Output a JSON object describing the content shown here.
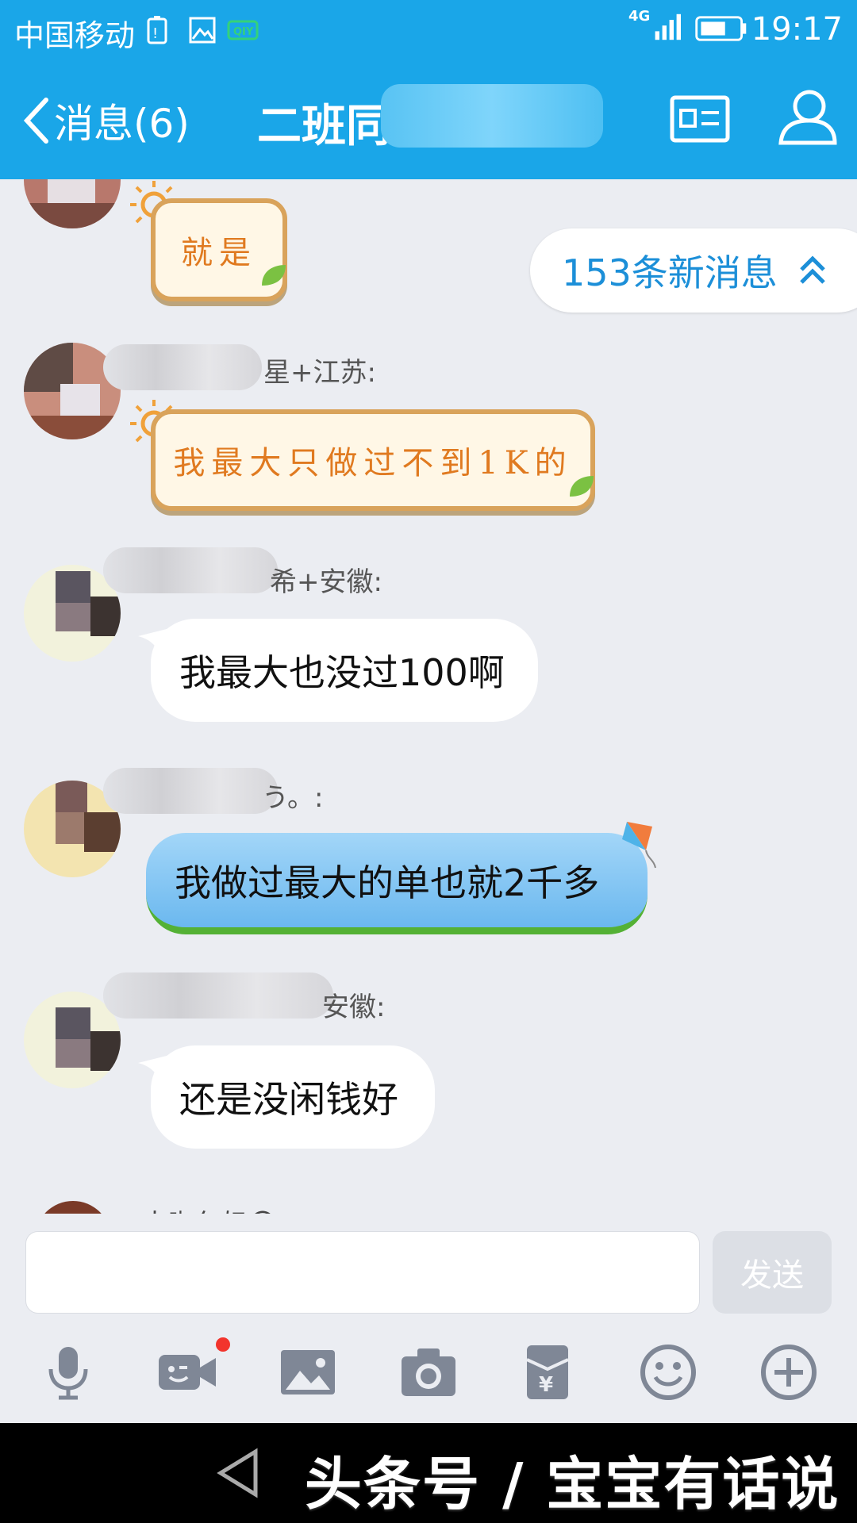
{
  "status_bar": {
    "carrier": "中国移动",
    "network": "4G",
    "time": "19:17"
  },
  "nav": {
    "back_label": "消息(6)",
    "title_visible": "二班同"
  },
  "new_messages": {
    "label": "153条新消息"
  },
  "messages": [
    {
      "sender_suffix": "",
      "text": "就是",
      "style": "sticker"
    },
    {
      "sender_suffix": "星+江苏:",
      "text": "我最大只做过不到1K的",
      "style": "sticker"
    },
    {
      "sender_suffix": "希+安徽:",
      "text": "我最大也没过100啊",
      "style": "white"
    },
    {
      "sender_suffix": "う。:",
      "text": "我做过最大的单也就2千多",
      "style": "blue"
    },
    {
      "sender_suffix": "安徽:",
      "text": "还是没闲钱好",
      "style": "white"
    },
    {
      "sender_suffix": "大咖包奶〇 :",
      "text": "",
      "style": "partial"
    }
  ],
  "input": {
    "placeholder": "",
    "send_label": "发送"
  },
  "toolbar": [
    "microphone-icon",
    "video-icon",
    "image-icon",
    "camera-icon",
    "red-packet-icon",
    "emoji-icon",
    "plus-icon"
  ],
  "watermark": "头条号 / 宝宝有话说",
  "colors": {
    "header": "#1aa6e8",
    "chat_bg": "#ebedf2",
    "accent": "#1c8fd8"
  }
}
